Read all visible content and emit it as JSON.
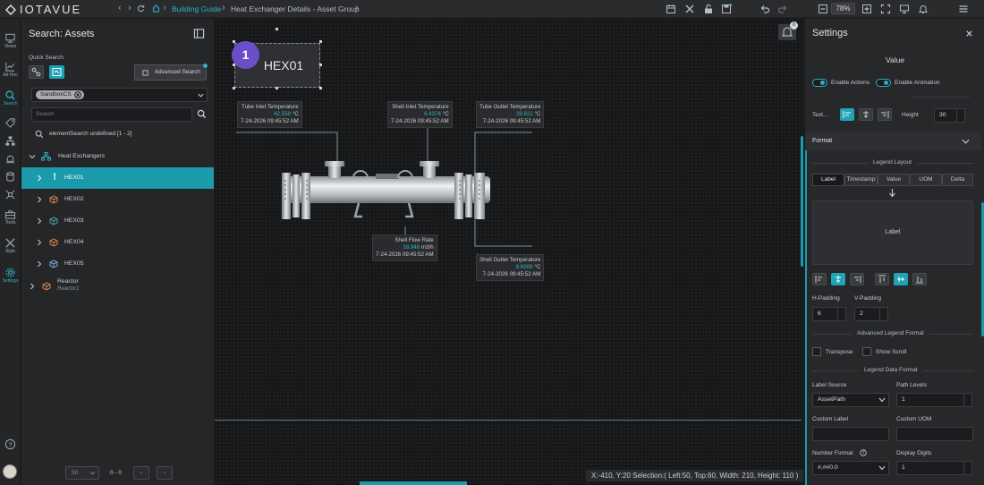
{
  "app": {
    "logo": "IOTAVUE"
  },
  "breadcrumb": {
    "item1": "Building Guide",
    "item2": "Heat Exchanger Details - Asset Group"
  },
  "toolbar": {
    "zoom": "78%"
  },
  "leftnav": [
    {
      "label": "Views",
      "icon": "views-icon"
    },
    {
      "label": "Ad Hoc",
      "icon": "chart-icon"
    },
    {
      "label": "Search",
      "icon": "search-icon"
    },
    {
      "label": "",
      "icon": "tag-icon"
    },
    {
      "label": "",
      "icon": "network-icon"
    },
    {
      "label": "",
      "icon": "alarm-icon"
    },
    {
      "label": "",
      "icon": "database-icon"
    },
    {
      "label": "",
      "icon": "transform-icon"
    },
    {
      "label": "Tools",
      "icon": "toolbox-icon"
    },
    {
      "label": "Style",
      "icon": "brush-icon"
    },
    {
      "label": "Settings",
      "icon": "gear-icon"
    }
  ],
  "search_panel": {
    "title": "Search: Assets",
    "quick_search": "Quick Search",
    "advanced_search": "Advanced Search",
    "chip": "SandboxCS",
    "search_placeholder": "Search",
    "element_search": "elementSearch undefined [1 - 2]",
    "tree": {
      "group": "Heat Exchangers",
      "items": [
        "HEX01",
        "HEX02",
        "HEX03",
        "HEX04",
        "HEX05"
      ],
      "reactor": "Reactor",
      "reactor_sub": "Reactor1"
    },
    "pager": {
      "size": "50",
      "range": "0 - 0"
    }
  },
  "canvas": {
    "title": "HEX01",
    "badge": "1",
    "notif_count": "0",
    "labels": [
      {
        "title": "Tube Inlet Temperature",
        "value": "42.558",
        "unit": "°C",
        "time": "7-24-2026 09:45:52 AM"
      },
      {
        "title": "Shell Inlet Temperature",
        "value": "6.4374",
        "unit": "°C",
        "time": "7-24-2026 09:45:52 AM"
      },
      {
        "title": "Tube Outlet Temperature",
        "value": "39.821",
        "unit": "°C",
        "time": "7-24-2026 09:45:52 AM"
      },
      {
        "title": "Shell Flow Rate",
        "value": "38.948",
        "unit": "m3/h",
        "time": "7-24-2026 09:45:52 AM"
      },
      {
        "title": "Shell Outlet Temperature",
        "value": "8.6989",
        "unit": "°C",
        "time": "7-24-2026 09:45:52 AM"
      }
    ],
    "status": "X:-410, Y:20  Selection:( Left:50, Top:60, Width: 210, Height: 110 )"
  },
  "settings": {
    "title": "Settings",
    "value_header": "Value",
    "enable_actions": "Enable Actions",
    "enable_animation": "Enable Animation",
    "text_label": "Text...",
    "height_label": "Height",
    "height_value": "30",
    "format": "Format",
    "legend_layout": "Legend Layout",
    "legend_tabs": [
      "Label",
      "Timestamp",
      "Value",
      "UOM",
      "Delta"
    ],
    "legend_box": "Label",
    "h_padding": "H-Padding",
    "v_padding": "V-Padding",
    "h_padding_value": "6",
    "v_padding_value": "2",
    "advanced_legend_format": "Advanced Legend Format",
    "transpose": "Transpose",
    "show_scroll": "Show Scroll",
    "legend_data_format": "Legend Data Format",
    "label_source": "Label Source",
    "label_source_value": "AssetPath",
    "path_levels": "Path Levels",
    "path_levels_value": "1",
    "custom_label": "Custom Label",
    "custom_uom": "Custom UOM",
    "number_format": "Number Format",
    "number_format_value": "#,##0.0",
    "display_digits": "Display Digits",
    "display_digits_value": "1"
  },
  "colors": {
    "accent": "#2ab0c5",
    "selected_row": "#1a9aab",
    "badge": "#6b4fc8"
  }
}
